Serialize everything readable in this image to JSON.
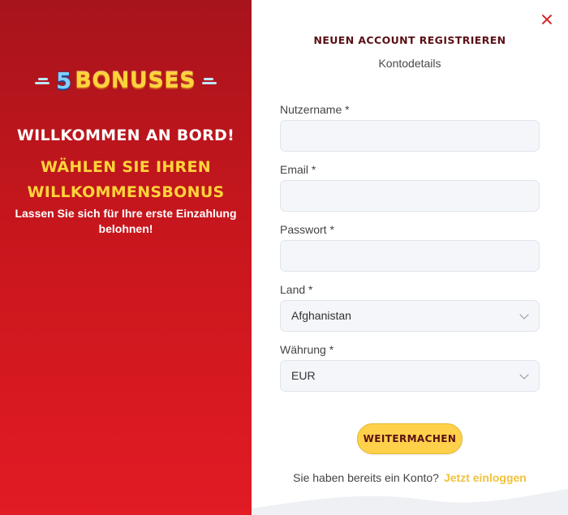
{
  "left": {
    "logo_number": "5",
    "logo_word": "BONUSES",
    "welcome": "WILLKOMMEN AN BORD!",
    "bonus_heading": "WÄHLEN SIE IHREN WILLKOMMENSBONUS",
    "reward_text": "Lassen Sie sich für Ihre erste Einzahlung belohnen!"
  },
  "form": {
    "title": "NEUEN ACCOUNT REGISTRIEREN",
    "subtitle": "Kontodetails",
    "fields": {
      "username_label": "Nutzername *",
      "username_value": "",
      "email_label": "Email *",
      "email_value": "",
      "password_label": "Passwort *",
      "password_value": "",
      "country_label": "Land *",
      "country_value": "Afghanistan",
      "currency_label": "Währung *",
      "currency_value": "EUR"
    },
    "continue_label": "WEITERMACHEN",
    "footer_text": "Sie haben bereits ein Konto?",
    "login_link": "Jetzt einloggen"
  },
  "icons": {
    "close": "close-icon",
    "select": "chevron-down-icon"
  },
  "colors": {
    "primary_red": "#d4222a",
    "gold": "#ffd43a",
    "button_gold": "#ffd14a",
    "dark_maroon": "#5a1016"
  }
}
